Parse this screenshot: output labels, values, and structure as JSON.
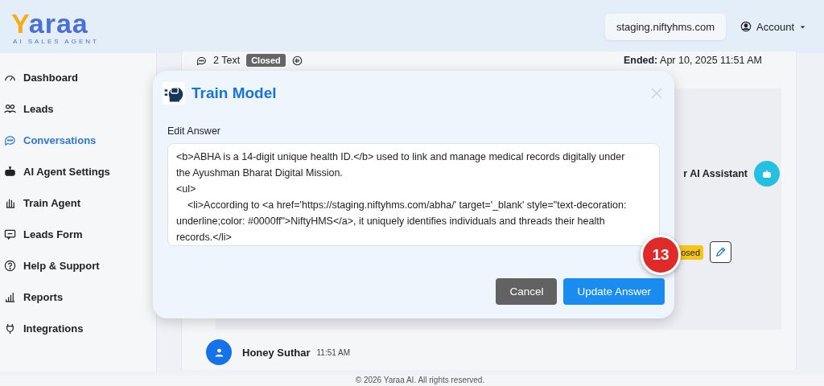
{
  "header": {
    "logo": "Yaraa",
    "tagline": "AI SALES AGENT",
    "domain": "staging.niftyhms.com",
    "account": "Account"
  },
  "sidebar": {
    "items": [
      {
        "label": "Dashboard",
        "selected": false
      },
      {
        "label": "Leads",
        "selected": false
      },
      {
        "label": "Conversations",
        "selected": true
      },
      {
        "label": "AI Agent Settings",
        "selected": false
      },
      {
        "label": "Train Agent",
        "selected": false
      },
      {
        "label": "Leads Form",
        "selected": false
      },
      {
        "label": "Help & Support",
        "selected": false
      },
      {
        "label": "Reports",
        "selected": false
      },
      {
        "label": "Integrations",
        "selected": false
      }
    ]
  },
  "conversation": {
    "message_count": "2 Text",
    "status": "Closed",
    "ended_label": "Ended:",
    "ended_time": "Apr 10, 2025 11:51 AM",
    "assistant_name": "r AI Assistant",
    "answer_status": "osed",
    "user_name": "Honey Suthar",
    "user_time": "11:51 AM"
  },
  "modal": {
    "title": "Train Model",
    "field_label": "Edit Answer",
    "answer": "<b>ABHA is a 14-digit unique health ID.</b> used to link and manage medical records digitally under the Ayushman Bharat Digital Mission.\n<ul>\n    <li>According to <a href='https://staging.niftyhms.com/abha/' target='_blank' style=\"text-decoration: underline;color: #0000ff\">NiftyHMS</a>, it uniquely identifies individuals and threads their health records.</li>",
    "buttons": [
      {
        "label": "Cancel",
        "kind": "secondary"
      },
      {
        "label": "Update Answer",
        "kind": "primary"
      }
    ]
  },
  "annotation_badge": "13",
  "footer": "© 2026 Yaraa AI. All rights reserved."
}
